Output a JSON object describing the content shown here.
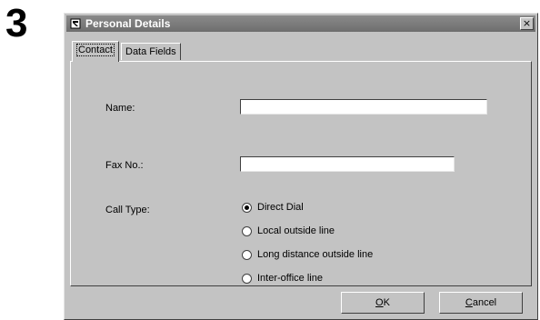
{
  "step": {
    "number": "3"
  },
  "dialog": {
    "title": "Personal Details",
    "close_symbol": "×"
  },
  "tabs": [
    {
      "label": "Contact",
      "active": true
    },
    {
      "label": "Data Fields",
      "active": false
    }
  ],
  "form": {
    "name_label": "Name:",
    "name_value": "",
    "fax_label": "Fax No.:",
    "fax_value": "",
    "call_type_label": "Call Type:",
    "call_type_options": [
      {
        "label": "Direct Dial",
        "selected": true
      },
      {
        "label": "Local outside line",
        "selected": false
      },
      {
        "label": "Long distance outside line",
        "selected": false
      },
      {
        "label": "Inter-office line",
        "selected": false
      }
    ]
  },
  "buttons": {
    "ok_first": "O",
    "ok_rest": "K",
    "cancel_first": "C",
    "cancel_rest": "ancel"
  },
  "icons": {
    "title_icon": "phone-book-icon",
    "close_icon": "close-icon"
  },
  "colors": {
    "dialog_face": "#c3c3c3",
    "titlebar": "#7a7a7a"
  }
}
